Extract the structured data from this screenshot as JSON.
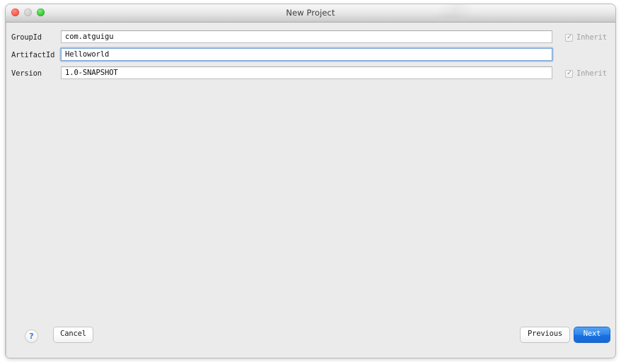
{
  "window": {
    "title": "New Project",
    "traffic_lights": [
      {
        "name": "close",
        "color": "#fb5d52"
      },
      {
        "name": "minimize",
        "color": "#cfcfcf"
      },
      {
        "name": "zoom",
        "color": "#3ecb3b"
      }
    ]
  },
  "form": {
    "rows": [
      {
        "label": "GroupId",
        "value": "com.atguigu",
        "focused": false,
        "inherit": {
          "label": "Inherit",
          "checked": true,
          "mark": "✓",
          "disabled": true
        }
      },
      {
        "label": "ArtifactId",
        "value": "Helloworld",
        "focused": true,
        "inherit": null
      },
      {
        "label": "Version",
        "value": "1.0-SNAPSHOT",
        "focused": false,
        "inherit": {
          "label": "Inherit",
          "checked": true,
          "mark": "✓",
          "disabled": true
        }
      }
    ]
  },
  "footer": {
    "help_label": "?",
    "cancel_label": "Cancel",
    "previous_label": "Previous",
    "next_label": "Next",
    "next_accent": "#1b72e0"
  }
}
